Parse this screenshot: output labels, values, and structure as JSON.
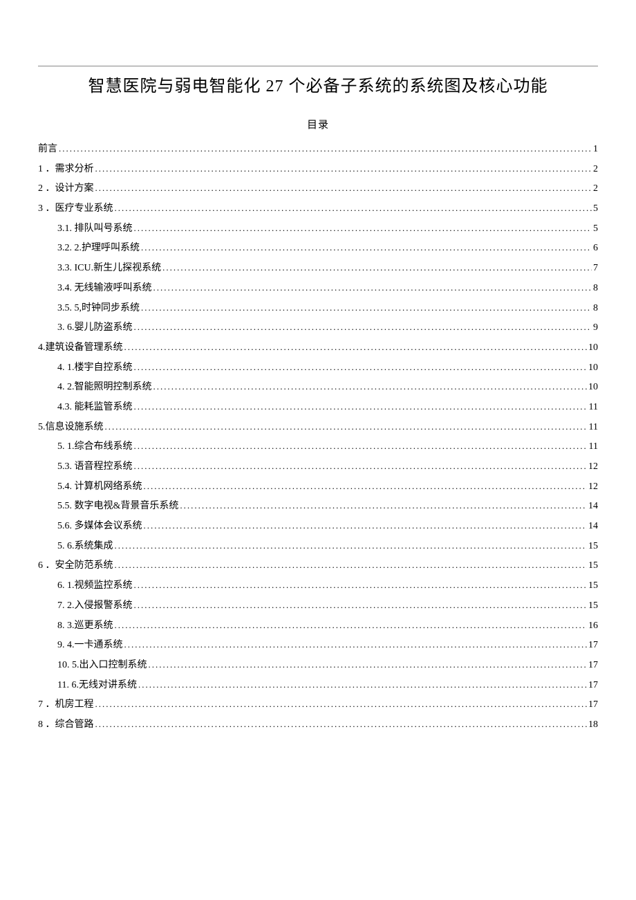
{
  "title_prefix": "智慧医院与弱电智能化 ",
  "title_number": "27",
  "title_suffix": " 个必备子系统的系统图及核心功能",
  "toc_header": "目录",
  "entries": [
    {
      "level": 0,
      "label": "前言 ",
      "page": "1"
    },
    {
      "level": 0,
      "label": "1 ．需求分析",
      "page": "2"
    },
    {
      "level": 0,
      "label": "2  ．设计方案",
      "page": "2"
    },
    {
      "level": 0,
      "label": "3  ．医疗专业系统",
      "page": "5"
    },
    {
      "level": 1,
      "label": "3.1.  排队叫号系统",
      "page": "5"
    },
    {
      "level": 1,
      "label": "3.2. 2.护理呼叫系统",
      "page": "6"
    },
    {
      "level": 1,
      "label": "3.3.  ICU.新生儿探视系统",
      "page": "7"
    },
    {
      "level": 1,
      "label": "3.4.  无线输液呼叫系统",
      "page": "8"
    },
    {
      "level": 1,
      "label": "3.5.  5,时钟同步系统",
      "page": "8"
    },
    {
      "level": 1,
      "label": "3.  6.婴儿防盗系统",
      "page": "9"
    },
    {
      "level": 0,
      "label": "4.建筑设备管理系统 ",
      "page": "10"
    },
    {
      "level": 1,
      "label": "4.  1.楼宇自控系统",
      "page": "10"
    },
    {
      "level": 1,
      "label": "4.  2.智能照明控制系统",
      "page": "10"
    },
    {
      "level": 1,
      "label": "4.3.  能耗监管系统 ",
      "page": "11"
    },
    {
      "level": 0,
      "label": "5.信息设施系统 ",
      "page": "11"
    },
    {
      "level": 1,
      "label": "5.  1.综合布线系统",
      "page": "11"
    },
    {
      "level": 1,
      "label": "5.3.  语音程控系统",
      "page": "12"
    },
    {
      "level": 1,
      "label": "5.4.  计算机网络系统",
      "page": "12"
    },
    {
      "level": 1,
      "label": "5.5.  数字电视&背景音乐系统",
      "page": "14"
    },
    {
      "level": 1,
      "label": "5.6.  多媒体会议系统",
      "page": "14"
    },
    {
      "level": 1,
      "label": "5.  6.系统集成",
      "page": "15"
    },
    {
      "level": 0,
      "label": "6 ．安全防范系统",
      "page": "15"
    },
    {
      "level": 1,
      "label": "6.  1.视频监控系统",
      "page": "15"
    },
    {
      "level": 1,
      "label": "7.  2.入侵报警系统",
      "page": "15"
    },
    {
      "level": 1,
      "label": "8.  3.巡更系统",
      "page": "16"
    },
    {
      "level": 1,
      "label": "9.  4.一卡通系统",
      "page": "17"
    },
    {
      "level": 1,
      "label": "10. 5.出入口控制系统",
      "page": "17"
    },
    {
      "level": 1,
      "label": "11. 6.无线对讲系统",
      "page": "17"
    },
    {
      "level": 0,
      "label": "7 ．机房工程",
      "page": "17"
    },
    {
      "level": 0,
      "label": "8 ．综合管路",
      "page": "18"
    }
  ]
}
